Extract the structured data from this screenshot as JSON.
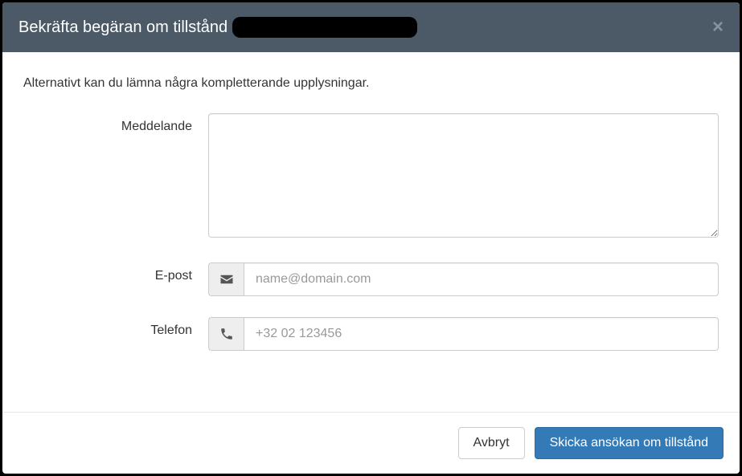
{
  "header": {
    "title": "Bekräfta begäran om tillstånd"
  },
  "body": {
    "intro": "Alternativt kan du lämna några kompletterande upplysningar.",
    "fields": {
      "message": {
        "label": "Meddelande",
        "value": ""
      },
      "email": {
        "label": "E-post",
        "value": "",
        "placeholder": "name@domain.com"
      },
      "phone": {
        "label": "Telefon",
        "value": "",
        "placeholder": "+32 02 123456"
      }
    }
  },
  "footer": {
    "cancel": "Avbryt",
    "submit": "Skicka ansökan om tillstånd"
  }
}
